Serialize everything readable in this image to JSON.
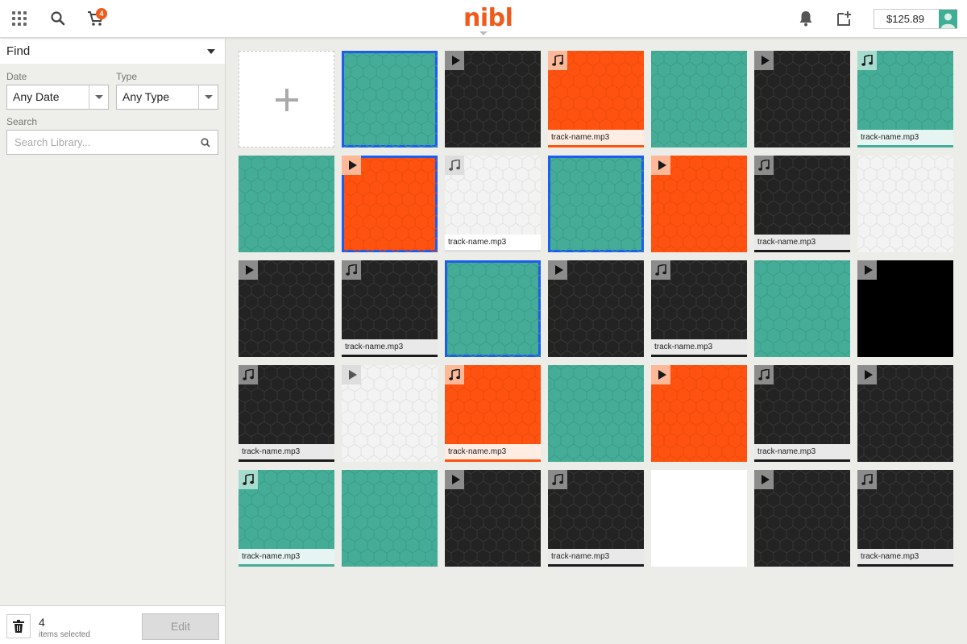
{
  "header": {
    "logo": "nibl",
    "cart_count": "4",
    "balance": "$125.89",
    "icons": [
      "apps-grid-icon",
      "search-icon",
      "cart-icon",
      "bell-icon",
      "add-to-library-icon",
      "user-avatar-icon"
    ]
  },
  "sidebar": {
    "find_label": "Find",
    "date_label": "Date",
    "date_value": "Any Date",
    "type_label": "Type",
    "type_value": "Any Type",
    "search_label": "Search",
    "search_placeholder": "Search Library..."
  },
  "footer": {
    "count": "4",
    "count_label": "items selected",
    "edit_label": "Edit"
  },
  "colors": {
    "accent": "#f05a1a",
    "teal": "#45ad97",
    "orange": "#fe5310",
    "dark": "#232323",
    "selection": "#1d5cf0"
  },
  "tiles": [
    {
      "color": "new",
      "badge": "",
      "label": "",
      "selected": false
    },
    {
      "color": "teal",
      "badge": "",
      "label": "",
      "selected": true
    },
    {
      "color": "dark",
      "badge": "play",
      "label": "",
      "selected": false
    },
    {
      "color": "orange",
      "badge": "music",
      "label": "track-name.mp3",
      "selected": false
    },
    {
      "color": "teal",
      "badge": "",
      "label": "",
      "selected": false
    },
    {
      "color": "dark",
      "badge": "play",
      "label": "",
      "selected": false
    },
    {
      "color": "teal",
      "badge": "music",
      "label": "track-name.mp3",
      "selected": false
    },
    {
      "color": "teal",
      "badge": "",
      "label": "",
      "selected": false
    },
    {
      "color": "orange",
      "badge": "play",
      "label": "",
      "selected": true
    },
    {
      "color": "light",
      "badge": "music",
      "label": "track-name.mp3",
      "selected": false
    },
    {
      "color": "teal",
      "badge": "",
      "label": "",
      "selected": true
    },
    {
      "color": "orange",
      "badge": "play",
      "label": "",
      "selected": false
    },
    {
      "color": "dark",
      "badge": "music",
      "label": "track-name.mp3",
      "selected": false
    },
    {
      "color": "light",
      "badge": "",
      "label": "",
      "selected": false
    },
    {
      "color": "dark",
      "badge": "play",
      "label": "",
      "selected": false
    },
    {
      "color": "dark",
      "badge": "music",
      "label": "track-name.mp3",
      "selected": false
    },
    {
      "color": "teal",
      "badge": "",
      "label": "",
      "selected": true
    },
    {
      "color": "dark",
      "badge": "play",
      "label": "",
      "selected": false
    },
    {
      "color": "dark",
      "badge": "music",
      "label": "track-name.mp3",
      "selected": false
    },
    {
      "color": "teal",
      "badge": "",
      "label": "",
      "selected": false
    },
    {
      "color": "black",
      "badge": "play",
      "label": "",
      "selected": false
    },
    {
      "color": "dark",
      "badge": "music",
      "label": "track-name.mp3",
      "selected": false
    },
    {
      "color": "light",
      "badge": "play",
      "label": "",
      "selected": false
    },
    {
      "color": "orange",
      "badge": "music",
      "label": "track-name.mp3",
      "selected": false
    },
    {
      "color": "teal",
      "badge": "",
      "label": "",
      "selected": false
    },
    {
      "color": "orange",
      "badge": "play",
      "label": "",
      "selected": false
    },
    {
      "color": "dark",
      "badge": "music",
      "label": "track-name.mp3",
      "selected": false
    },
    {
      "color": "dark",
      "badge": "play",
      "label": "",
      "selected": false
    },
    {
      "color": "teal",
      "badge": "music",
      "label": "track-name.mp3",
      "selected": false
    },
    {
      "color": "teal",
      "badge": "",
      "label": "",
      "selected": false
    },
    {
      "color": "dark",
      "badge": "play",
      "label": "",
      "selected": false
    },
    {
      "color": "dark",
      "badge": "music",
      "label": "track-name.mp3",
      "selected": false
    },
    {
      "color": "white",
      "badge": "",
      "label": "",
      "selected": false
    },
    {
      "color": "dark",
      "badge": "play",
      "label": "",
      "selected": false
    },
    {
      "color": "dark",
      "badge": "music",
      "label": "track-name.mp3",
      "selected": false
    }
  ]
}
